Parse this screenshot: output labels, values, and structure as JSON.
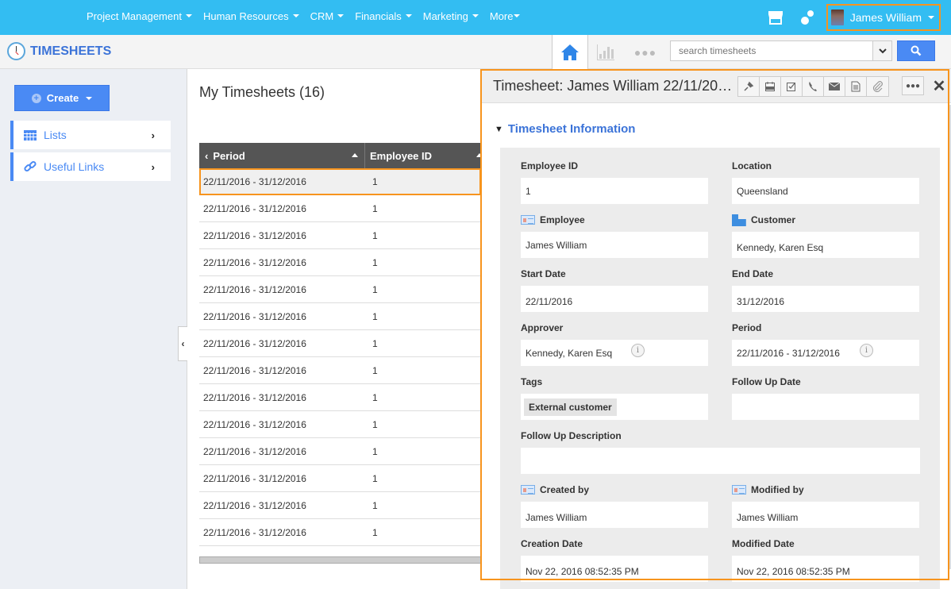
{
  "topnav": {
    "items": [
      {
        "label": "Project Management"
      },
      {
        "label": "Human Resources"
      },
      {
        "label": "CRM"
      },
      {
        "label": "Financials"
      },
      {
        "label": "Marketing"
      },
      {
        "label": "More"
      }
    ],
    "user_name": "James William"
  },
  "subbar": {
    "app_title": "TIMESHEETS",
    "search_placeholder": "search timesheets"
  },
  "sidebar": {
    "create_label": "Create",
    "items": [
      {
        "label": "Lists",
        "icon": "calendar-grid-icon"
      },
      {
        "label": "Useful Links",
        "icon": "link-icon"
      }
    ]
  },
  "list": {
    "title": "My Timesheets (16)",
    "columns": [
      "Period",
      "Employee ID"
    ],
    "rows": [
      {
        "period": "22/11/2016 - 31/12/2016",
        "employee_id": "1"
      },
      {
        "period": "22/11/2016 - 31/12/2016",
        "employee_id": "1"
      },
      {
        "period": "22/11/2016 - 31/12/2016",
        "employee_id": "1"
      },
      {
        "period": "22/11/2016 - 31/12/2016",
        "employee_id": "1"
      },
      {
        "period": "22/11/2016 - 31/12/2016",
        "employee_id": "1"
      },
      {
        "period": "22/11/2016 - 31/12/2016",
        "employee_id": "1"
      },
      {
        "period": "22/11/2016 - 31/12/2016",
        "employee_id": "1"
      },
      {
        "period": "22/11/2016 - 31/12/2016",
        "employee_id": "1"
      },
      {
        "period": "22/11/2016 - 31/12/2016",
        "employee_id": "1"
      },
      {
        "period": "22/11/2016 - 31/12/2016",
        "employee_id": "1"
      },
      {
        "period": "22/11/2016 - 31/12/2016",
        "employee_id": "1"
      },
      {
        "period": "22/11/2016 - 31/12/2016",
        "employee_id": "1"
      },
      {
        "period": "22/11/2016 - 31/12/2016",
        "employee_id": "1"
      },
      {
        "period": "22/11/2016 - 31/12/2016",
        "employee_id": "1"
      }
    ]
  },
  "detail": {
    "title": "Timesheet: James William 22/11/20…",
    "section_title": "Timesheet Information",
    "toolbar": [
      "pin-icon",
      "calendar-icon",
      "task-check-icon",
      "phone-icon",
      "email-icon",
      "note-icon",
      "attachment-icon"
    ],
    "fields": {
      "employee_id": {
        "label": "Employee ID",
        "value": "1"
      },
      "location": {
        "label": "Location",
        "value": "Queensland"
      },
      "employee": {
        "label": "Employee",
        "value": "James William"
      },
      "customer": {
        "label": "Customer",
        "value": "Kennedy, Karen Esq"
      },
      "start_date": {
        "label": "Start Date",
        "value": "22/11/2016"
      },
      "end_date": {
        "label": "End Date",
        "value": "31/12/2016"
      },
      "approver": {
        "label": "Approver",
        "value": "Kennedy, Karen Esq"
      },
      "period": {
        "label": "Period",
        "value": "22/11/2016 - 31/12/2016"
      },
      "tags": {
        "label": "Tags",
        "value": "External customer"
      },
      "follow_up_date": {
        "label": "Follow Up Date",
        "value": ""
      },
      "follow_up_description": {
        "label": "Follow Up Description",
        "value": ""
      },
      "created_by": {
        "label": "Created by",
        "value": "James William"
      },
      "modified_by": {
        "label": "Modified by",
        "value": "James William"
      },
      "creation_date": {
        "label": "Creation Date",
        "value": "Nov 22, 2016 08:52:35 PM"
      },
      "modified_date": {
        "label": "Modified Date",
        "value": "Nov 22, 2016 08:52:35 PM"
      }
    }
  },
  "colors": {
    "topbar": "#33bdf2",
    "accent": "#4a8af4",
    "highlight": "#f7941d",
    "grid_header": "#555555"
  }
}
